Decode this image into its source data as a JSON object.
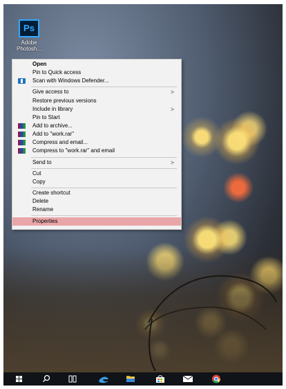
{
  "desktop": {
    "photoshop_icon": {
      "badge": "Ps",
      "label": "Adobe Photosh..."
    }
  },
  "context_menu": {
    "items": [
      {
        "label": "Open",
        "bold": true
      },
      {
        "label": "Pin to Quick access"
      },
      {
        "label": "Scan with Windows Defender...",
        "icon": "windows-defender-icon"
      },
      {
        "label": "Give access to",
        "submenu": true
      },
      {
        "label": "Restore previous versions"
      },
      {
        "label": "Include in library",
        "submenu": true
      },
      {
        "label": "Pin to Start"
      },
      {
        "label": "Add to archive...",
        "icon": "winrar-icon"
      },
      {
        "label": "Add to \"work.rar\"",
        "icon": "winrar-icon"
      },
      {
        "label": "Compress and email...",
        "icon": "winrar-icon"
      },
      {
        "label": "Compress to \"work.rar\" and email",
        "icon": "winrar-icon"
      },
      {
        "label": "Send to",
        "submenu": true
      },
      {
        "label": "Cut"
      },
      {
        "label": "Copy"
      },
      {
        "label": "Create shortcut"
      },
      {
        "label": "Delete"
      },
      {
        "label": "Rename"
      },
      {
        "label": "Properties",
        "highlighted": true
      }
    ],
    "submenu_arrow": ">",
    "highlight_color": "#e9a6a8"
  },
  "taskbar": {
    "icons": [
      "windows-start-icon",
      "search-icon",
      "task-view-icon",
      "edge-icon",
      "file-explorer-icon",
      "store-icon",
      "mail-icon",
      "chrome-icon"
    ]
  }
}
